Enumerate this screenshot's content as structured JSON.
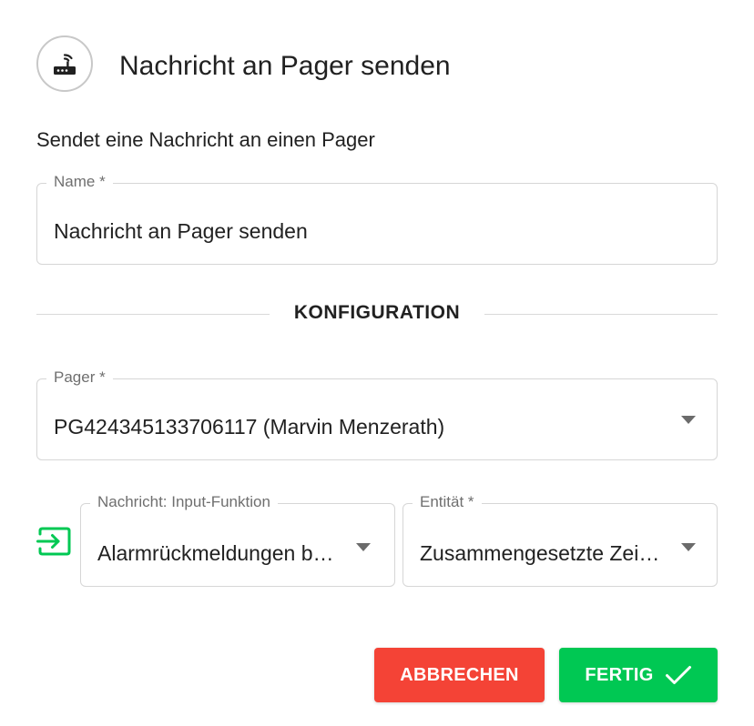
{
  "dialog": {
    "title": "Nachricht an Pager senden",
    "icon": "router-icon",
    "description": "Sendet eine Nachricht an einen Pager"
  },
  "name_field": {
    "label": "Name *",
    "value": "Nachricht an Pager senden"
  },
  "section": {
    "title": "KONFIGURATION"
  },
  "pager_field": {
    "label": "Pager *",
    "value": "PG424345133706117 (Marvin Menzerath)"
  },
  "message_field": {
    "label": "Nachricht: Input-Funktion",
    "value": "Alarmrückmeldungen b…",
    "icon": "input-icon"
  },
  "entity_field": {
    "label": "Entität *",
    "value": "Zusammengesetzte Zei…"
  },
  "buttons": {
    "cancel_label": "ABBRECHEN",
    "done_label": "FERTIG"
  },
  "colors": {
    "cancel": "#f44336",
    "done": "#00c853",
    "input_icon": "#00c853"
  }
}
